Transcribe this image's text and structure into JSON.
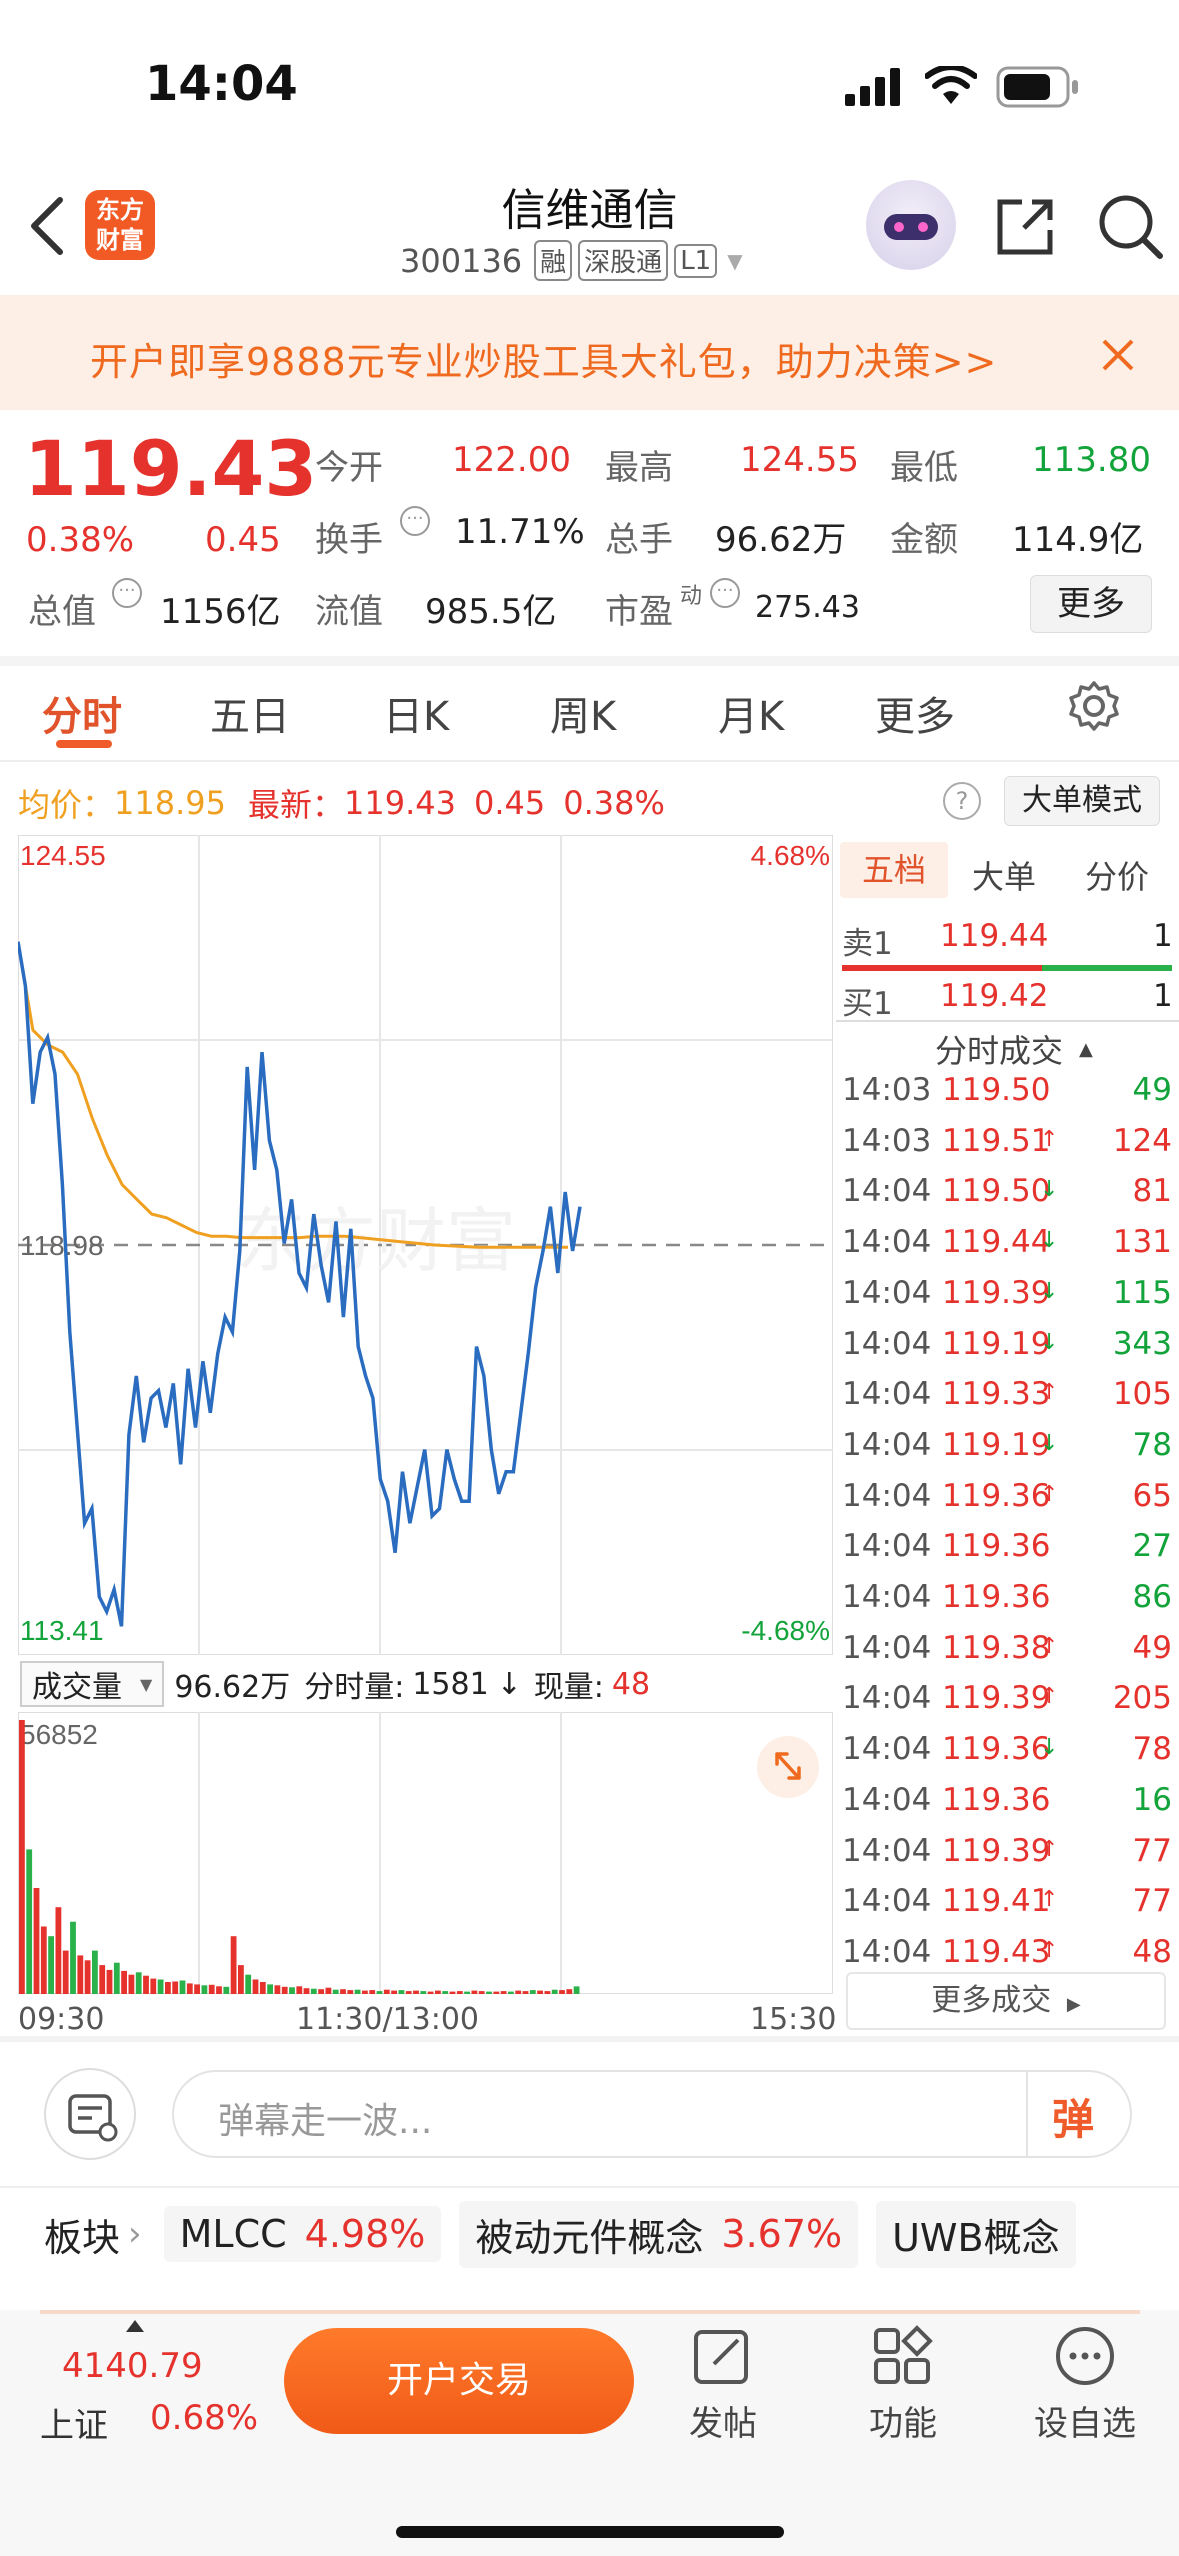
{
  "status": {
    "time": "14:04"
  },
  "header": {
    "logo_text": "东方\n财富",
    "logo_line1": "东方",
    "logo_line2": "财富",
    "title": "信维通信",
    "code": "300136",
    "badges": [
      "融",
      "深股通",
      "L1"
    ]
  },
  "banner": {
    "text": "开户即享9888元专业炒股工具大礼包，助力决策>>"
  },
  "quote": {
    "price": "119.43",
    "change_pct": "0.38%",
    "change": "0.45",
    "open_label": "今开",
    "open": "122.00",
    "high_label": "最高",
    "high": "124.55",
    "low_label": "最低",
    "low": "113.80",
    "turnover_label": "换手",
    "turnover": "11.71%",
    "volume_label": "总手",
    "volume": "96.62万",
    "amount_label": "金额",
    "amount": "114.9亿",
    "mktcap_label": "总值",
    "mktcap": "1156亿",
    "float_label": "流值",
    "float": "985.5亿",
    "pe_label": "市盈",
    "pe_sup": "动",
    "pe": "275.43",
    "more_button": "更多"
  },
  "tabs": [
    "分时",
    "五日",
    "日K",
    "周K",
    "月K",
    "更多"
  ],
  "info": {
    "avg_label": "均价：",
    "avg": "118.95",
    "latest_label": "最新：",
    "latest": "119.43",
    "latest_chg": "0.45",
    "latest_pct": "0.38%",
    "big_order_button": "大单模式"
  },
  "chart": {
    "y_max": "124.55",
    "y_min": "113.41",
    "y_mid": "118.98",
    "pct_max": "4.68%",
    "pct_min": "-4.68%",
    "volume_label": "成交量",
    "volume_total": "96.62万",
    "tick_vol_label": "分时量:",
    "tick_vol": "1581",
    "now_vol_label": "现量:",
    "now_vol": "48",
    "vol_max": "56852",
    "x_labels": [
      "09:30",
      "11:30/13:00",
      "15:30"
    ],
    "watermark": "东方财富"
  },
  "chart_data": {
    "type": "line",
    "title": "",
    "xlabel": "",
    "ylabel": "",
    "ylim": [
      113.41,
      124.55
    ],
    "x_range": [
      "09:30",
      "15:30"
    ],
    "series": [
      {
        "values": [
          123.1,
          122.5,
          120.9,
          121.6,
          121.8,
          121.3,
          119.8,
          117.8,
          116.5,
          115.2,
          115.4,
          114.2,
          114.0,
          114.3,
          113.8,
          116.4,
          117.2,
          116.3,
          116.9,
          117.0,
          116.5,
          117.1,
          116.0,
          117.3,
          116.5,
          117.4,
          116.7,
          117.5,
          118.0,
          117.8,
          118.9,
          121.4,
          120.0,
          121.6,
          120.4,
          120.0,
          119.0,
          119.6,
          118.6,
          118.4,
          119.4,
          118.7,
          118.2,
          119.3,
          118.0,
          119.2,
          117.6,
          117.2,
          116.9,
          115.8,
          115.5,
          114.8,
          115.9,
          115.2,
          115.7,
          116.2,
          115.3,
          115.4,
          116.2,
          115.8,
          115.5,
          115.5,
          117.6,
          117.2,
          116.2,
          115.6,
          115.9,
          115.9,
          116.7,
          117.5,
          118.4,
          118.9,
          119.5,
          118.6,
          119.7,
          118.9,
          119.5
        ]
      },
      {
        "values": [
          123.1,
          121.9,
          121.7,
          121.6,
          121.3,
          120.7,
          120.2,
          119.8,
          119.6,
          119.4,
          119.35,
          119.25,
          119.15,
          119.1,
          119.1,
          119.08,
          119.08,
          119.08,
          119.08,
          119.08,
          119.1,
          119.1,
          119.1,
          119.08,
          119.06,
          119.04,
          119.02,
          119.0,
          118.98,
          118.97,
          118.96,
          118.95,
          118.95,
          118.95,
          118.95,
          118.95,
          118.95,
          118.95
        ]
      }
    ],
    "volume": [
      56852,
      30000,
      22000,
      14000,
      12000,
      18000,
      9000,
      15000,
      8000,
      7000,
      9000,
      6000,
      5000,
      6500,
      4800,
      4000,
      4500,
      3800,
      3200,
      3000,
      2500,
      2600,
      2800,
      2200,
      2000,
      1800,
      1900,
      1600,
      1500,
      12000,
      6000,
      4000,
      3000,
      2500,
      2000,
      1800,
      1500,
      1400,
      1600,
      1200,
      1100,
      1000,
      1300,
      900,
      1000,
      800,
      900,
      700,
      800,
      600,
      900,
      700,
      800,
      600,
      700,
      600,
      500,
      700,
      600,
      500,
      600,
      500,
      700,
      600,
      500,
      500,
      600,
      500,
      700,
      600,
      800,
      700,
      600,
      900,
      800,
      1000,
      1581
    ]
  },
  "order_book": {
    "tabs": [
      "五档",
      "大单",
      "分价"
    ],
    "sell_label": "卖1",
    "sell_price": "119.44",
    "sell_vol": "1",
    "buy_label": "买1",
    "buy_price": "119.42",
    "buy_vol": "1",
    "ticks_title": "分时成交",
    "more_ticks": "更多成交"
  },
  "ticks": [
    {
      "t": "14:03",
      "p": "119.50",
      "d": "",
      "v": "49"
    },
    {
      "t": "14:03",
      "p": "119.51",
      "d": "↑",
      "v": "124"
    },
    {
      "t": "14:04",
      "p": "119.50",
      "d": "↓",
      "v": "81"
    },
    {
      "t": "14:04",
      "p": "119.44",
      "d": "↓",
      "v": "131"
    },
    {
      "t": "14:04",
      "p": "119.39",
      "d": "↓",
      "v": "115"
    },
    {
      "t": "14:04",
      "p": "119.19",
      "d": "↓",
      "v": "343"
    },
    {
      "t": "14:04",
      "p": "119.33",
      "d": "↑",
      "v": "105"
    },
    {
      "t": "14:04",
      "p": "119.19",
      "d": "↓",
      "v": "78"
    },
    {
      "t": "14:04",
      "p": "119.36",
      "d": "↑",
      "v": "65"
    },
    {
      "t": "14:04",
      "p": "119.36",
      "d": "",
      "v": "27"
    },
    {
      "t": "14:04",
      "p": "119.36",
      "d": "",
      "v": "86"
    },
    {
      "t": "14:04",
      "p": "119.38",
      "d": "↑",
      "v": "49"
    },
    {
      "t": "14:04",
      "p": "119.39",
      "d": "↑",
      "v": "205"
    },
    {
      "t": "14:04",
      "p": "119.36",
      "d": "↓",
      "v": "78"
    },
    {
      "t": "14:04",
      "p": "119.36",
      "d": "",
      "v": "16"
    },
    {
      "t": "14:04",
      "p": "119.39",
      "d": "↑",
      "v": "77"
    },
    {
      "t": "14:04",
      "p": "119.41",
      "d": "↑",
      "v": "77"
    },
    {
      "t": "14:04",
      "p": "119.43",
      "d": "↑",
      "v": "48"
    }
  ],
  "danmu": {
    "placeholder": "弹幕走一波...",
    "send_label": "弹"
  },
  "sectors": {
    "label": "板块",
    "items": [
      {
        "name": "MLCC",
        "pct": "4.98%"
      },
      {
        "name": "被动元件概念",
        "pct": "3.67%"
      },
      {
        "name": "UWB概念",
        "pct": ""
      }
    ]
  },
  "bottom": {
    "index_value": "4140.79",
    "index_name": "上证",
    "index_pct": "0.68%",
    "trade_button": "开户交易",
    "post_label": "发帖",
    "func_label": "功能",
    "watch_label": "设自选"
  }
}
